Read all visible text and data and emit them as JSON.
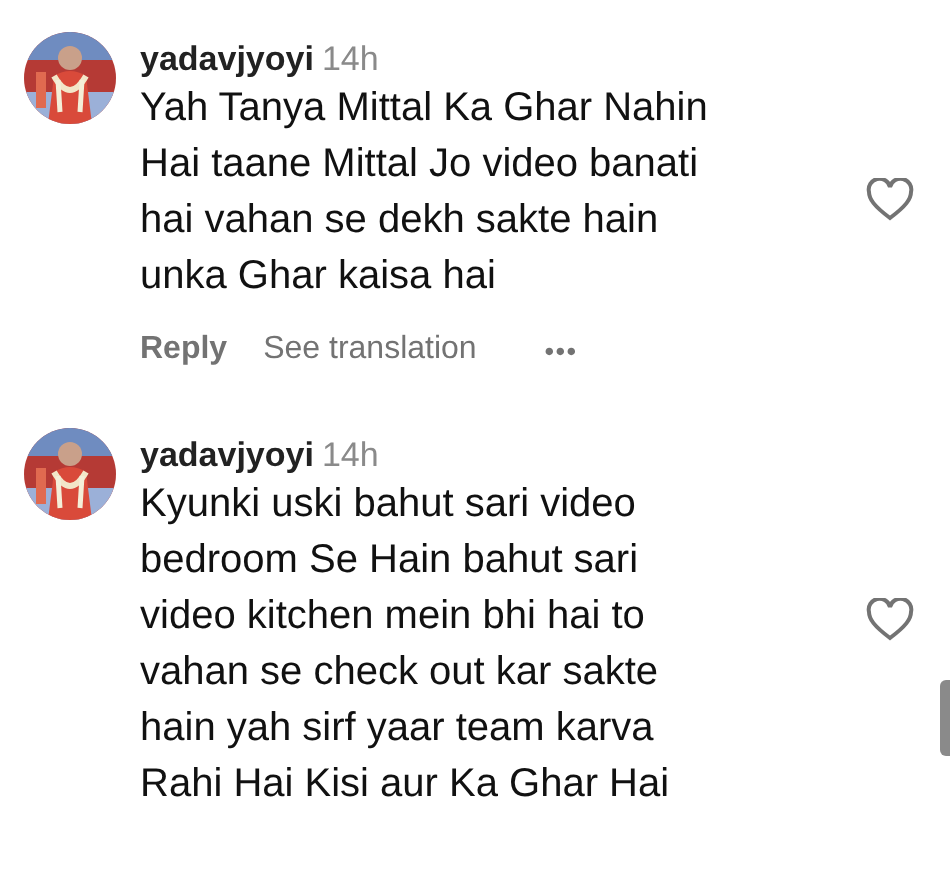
{
  "comments": [
    {
      "username": "yadavjyoyi",
      "time": "14h",
      "text": "Yah Tanya Mittal Ka Ghar Nahin\nHai taane Mittal Jo video banati\nhai vahan se dekh sakte hain\nunka Ghar kaisa hai",
      "liked": false,
      "actions": [
        "Reply",
        "See translation"
      ],
      "more": "•••"
    },
    {
      "username": "yadavjyoyi",
      "time": "14h",
      "text": "Kyunki uski bahut sari video\nbedroom Se Hain bahut sari\nvideo kitchen mein bhi hai to\nvahan se check out kar sakte\nhain yah sirf yaar team karva\nRahi Hai Kisi aur Ka Ghar Hai",
      "liked": false
    }
  ]
}
